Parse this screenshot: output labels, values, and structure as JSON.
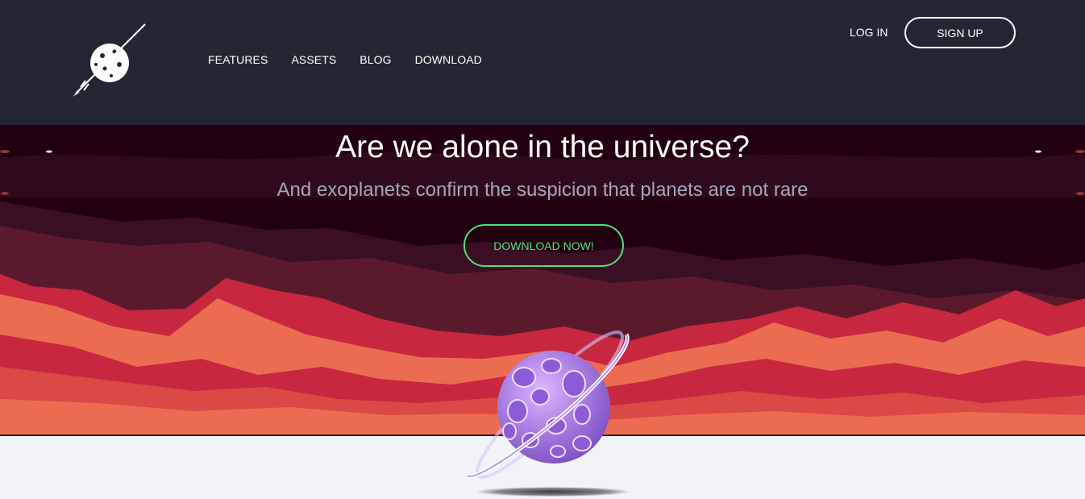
{
  "header": {
    "logo_icon": "planet-spear-logo",
    "nav": [
      "FEATURES",
      "ASSETS",
      "BLOG",
      "DOWNLOAD"
    ],
    "login_label": "LOG IN",
    "signup_label": "SIGN UP"
  },
  "hero": {
    "title": "Are we alone in the universe?",
    "subtitle": "And exoplanets confirm the suspicion that planets are not rare",
    "cta_label": "DOWNLOAD NOW!",
    "illustration_icon": "purple-planet-with-ring"
  },
  "colors": {
    "header_bg": "#222733",
    "hero_sky": "#22000f",
    "mountain_dark": "#5a1a2c",
    "mountain_red": "#c7283f",
    "mountain_orange": "#ec6c52",
    "cta_green": "#4ee07a",
    "page_bg": "#f2f3f7",
    "planet_purple": "#a77be0"
  }
}
